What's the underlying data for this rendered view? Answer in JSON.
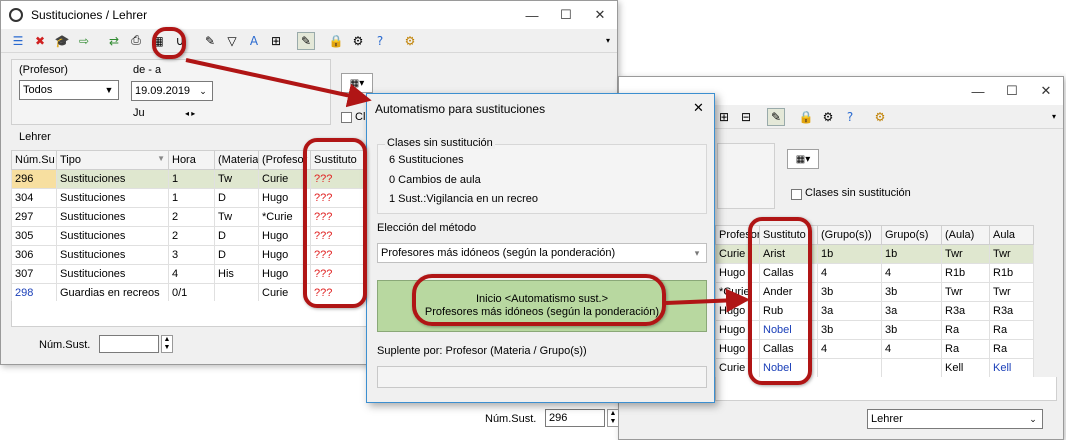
{
  "win1": {
    "title": "Sustituciones / Lehrer",
    "profesor_label": "(Profesor)",
    "profesor_value": "Todos",
    "range_label": "de - a",
    "date_value": "19.09.2019",
    "day_label": "Ju",
    "cl_label": "Cl",
    "section_label": "Lehrer",
    "columns": [
      "Núm.Su",
      "Tipo",
      "Hora",
      "(Materia",
      "(Profesor",
      "Sustituto"
    ],
    "rows": [
      {
        "num": "296",
        "tipo": "Sustituciones",
        "hora": "1",
        "materia": "Tw",
        "profesor": "Curie",
        "sust": "???"
      },
      {
        "num": "304",
        "tipo": "Sustituciones",
        "hora": "1",
        "materia": "D",
        "profesor": "Hugo",
        "sust": "???"
      },
      {
        "num": "297",
        "tipo": "Sustituciones",
        "hora": "2",
        "materia": "Tw",
        "profesor": "*Curie",
        "sust": "???"
      },
      {
        "num": "305",
        "tipo": "Sustituciones",
        "hora": "2",
        "materia": "D",
        "profesor": "Hugo",
        "sust": "???"
      },
      {
        "num": "306",
        "tipo": "Sustituciones",
        "hora": "3",
        "materia": "D",
        "profesor": "Hugo",
        "sust": "???"
      },
      {
        "num": "307",
        "tipo": "Sustituciones",
        "hora": "4",
        "materia": "His",
        "profesor": "Hugo",
        "sust": "???"
      },
      {
        "num": "298",
        "tipo": "Guardias en recreos",
        "hora": "0/1",
        "materia": "",
        "profesor": "Curie",
        "sust": "???"
      }
    ],
    "num_sust_label": "Núm.Sust.",
    "num_sust_value": ""
  },
  "win2": {
    "clases_sin_label": "Clases sin sustitución",
    "columns": [
      "Profesor",
      "Sustituto",
      "(Grupo(s))",
      "Grupo(s)",
      "(Aula)",
      "Aula"
    ],
    "rows": [
      {
        "profesor": "Curie",
        "sust": "Arist",
        "grupo_p": "1b",
        "grupo": "1b",
        "aula_p": "Twr",
        "aula": "Twr"
      },
      {
        "profesor": "Hugo",
        "sust": "Callas",
        "grupo_p": "4",
        "grupo": "4",
        "aula_p": "R1b",
        "aula": "R1b"
      },
      {
        "profesor": "*Curie",
        "sust": "Ander",
        "grupo_p": "3b",
        "grupo": "3b",
        "aula_p": "Twr",
        "aula": "Twr"
      },
      {
        "profesor": "Hugo",
        "sust": "Rub",
        "grupo_p": "3a",
        "grupo": "3a",
        "aula_p": "R3a",
        "aula": "R3a"
      },
      {
        "profesor": "Hugo",
        "sust": "Nobel",
        "grupo_p": "3b",
        "grupo": "3b",
        "aula_p": "Ra",
        "aula": "Ra"
      },
      {
        "profesor": "Hugo",
        "sust": "Callas",
        "grupo_p": "4",
        "grupo": "4",
        "aula_p": "Ra",
        "aula": "Ra"
      },
      {
        "profesor": "Curie",
        "sust": "Nobel",
        "grupo_p": "",
        "grupo": "",
        "aula_p": "Kell",
        "aula": "Kell"
      }
    ],
    "num_sust_label": "Núm.Sust.",
    "num_sust_value": "296",
    "view_select": "Lehrer"
  },
  "dialog": {
    "title": "Automatismo para sustituciones",
    "group_label": "Clases sin sustitución",
    "line1": "6 Sustituciones",
    "line2": "0 Cambios de aula",
    "line3": "1 Sust.:Vigilancia en un recreo",
    "method_label": "Elección del método",
    "method_value": "Profesores más idóneos (según la ponderación)",
    "start_line1": "Inicio <Automatismo sust.>",
    "start_line2": "Profesores más idóneos (según la ponderación)",
    "suplente_label": "Suplente por: Profesor (Materia / Grupo(s))"
  },
  "colors": {
    "accent_red": "#b01515",
    "selected_row": "#dfe7cf",
    "start_button": "#b8d8a0",
    "missing_text": "#e02020",
    "link_blue": "#1a3fb8"
  }
}
